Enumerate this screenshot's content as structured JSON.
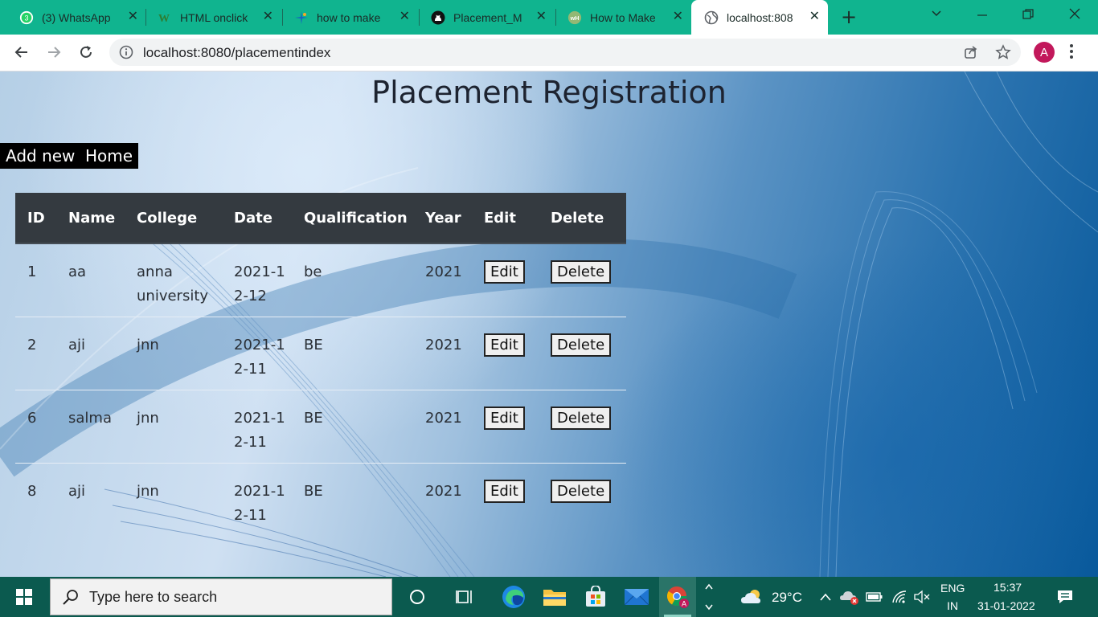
{
  "browser": {
    "tabs": [
      {
        "label": "(3) WhatsApp",
        "icon": "whatsapp-icon"
      },
      {
        "label": "HTML onclick",
        "icon": "w3schools-icon"
      },
      {
        "label": "how to make",
        "icon": "sparkle-icon"
      },
      {
        "label": "Placement_M",
        "icon": "github-icon"
      },
      {
        "label": "How to Make",
        "icon": "wikihow-icon"
      },
      {
        "label": "localhost:808",
        "icon": "globe-icon",
        "active": true
      }
    ],
    "url": "localhost:8080/placementindex",
    "profile_initial": "A"
  },
  "page": {
    "title": "Placement Registration",
    "actions": {
      "add_new": "Add new",
      "home": "Home"
    },
    "table": {
      "headers": {
        "id": "ID",
        "name": "Name",
        "college": "College",
        "date": "Date",
        "qualification": "Qualification",
        "year": "Year",
        "edit": "Edit",
        "delete": "Delete"
      },
      "rows": [
        {
          "id": "1",
          "name": "aa",
          "college": "anna university",
          "date": "2021-12-12",
          "qualification": "be",
          "year": "2021",
          "edit": "Edit",
          "delete": "Delete"
        },
        {
          "id": "2",
          "name": "aji",
          "college": "jnn",
          "date": "2021-12-11",
          "qualification": "BE",
          "year": "2021",
          "edit": "Edit",
          "delete": "Delete"
        },
        {
          "id": "6",
          "name": "salma",
          "college": "jnn",
          "date": "2021-12-11",
          "qualification": "BE",
          "year": "2021",
          "edit": "Edit",
          "delete": "Delete"
        },
        {
          "id": "8",
          "name": "aji",
          "college": "jnn",
          "date": "2021-12-11",
          "qualification": "BE",
          "year": "2021",
          "edit": "Edit",
          "delete": "Delete"
        }
      ]
    }
  },
  "taskbar": {
    "search_placeholder": "Type here to search",
    "weather": "29°C",
    "language": "ENG",
    "region": "IN",
    "time": "15:37",
    "date": "31-01-2022"
  },
  "colors": {
    "tabstrip": "#10b48f",
    "taskbar": "#0b5a4f",
    "table_header": "#343a40",
    "avatar": "#c2185b"
  }
}
